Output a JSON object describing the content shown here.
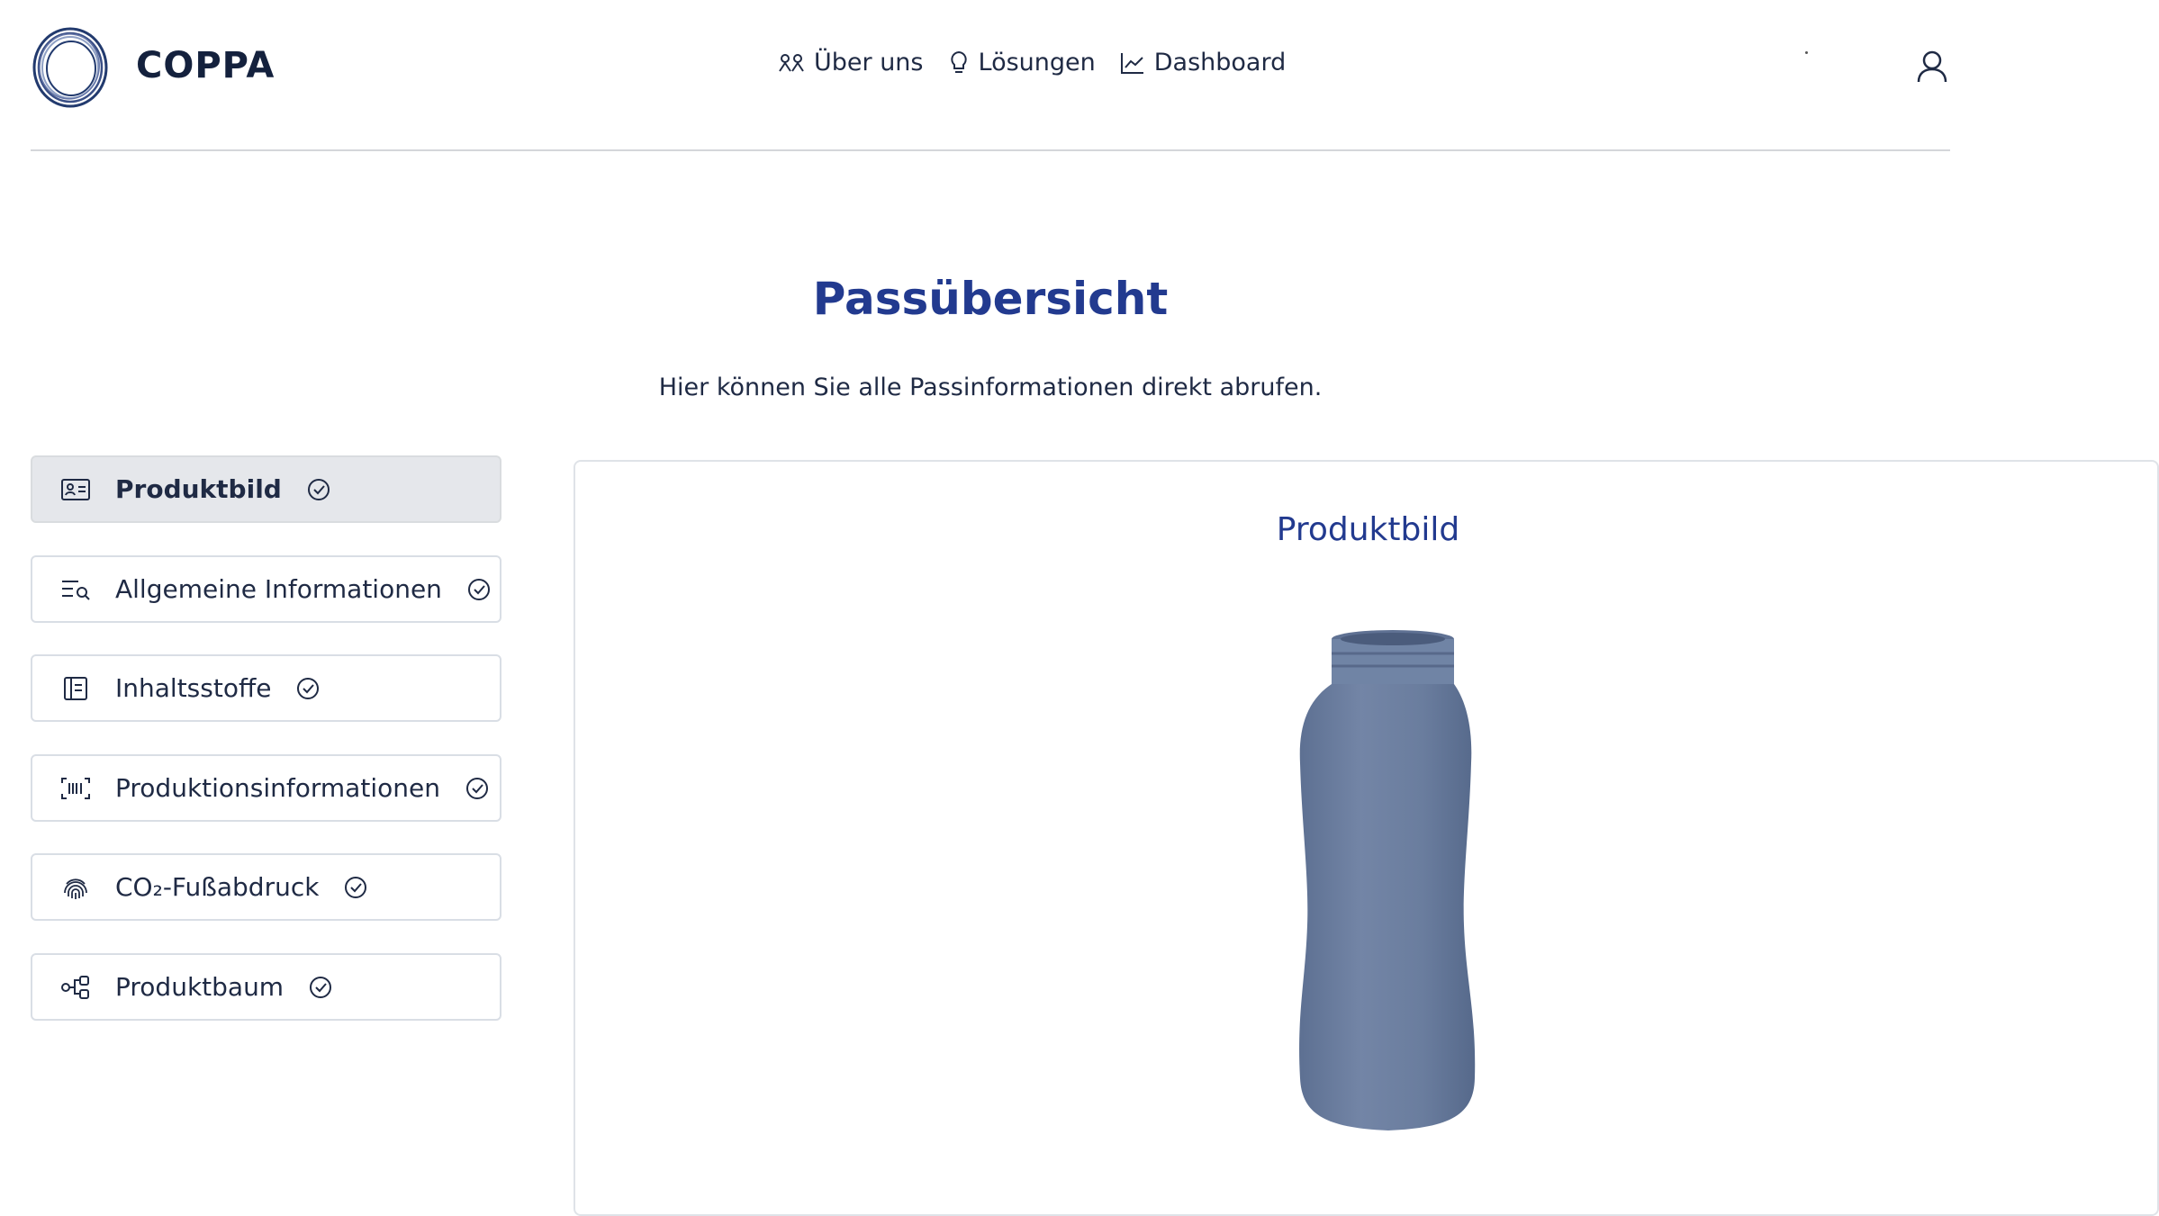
{
  "brand": {
    "name": "COPPA"
  },
  "nav": [
    {
      "label": "Über uns",
      "icon": "users-icon"
    },
    {
      "label": "Lösungen",
      "icon": "lightbulb-icon"
    },
    {
      "label": "Dashboard",
      "icon": "chart-line-icon"
    }
  ],
  "header": {
    "title": "Passübersicht",
    "subtitle": "Hier können Sie alle Passinformationen direkt abrufen."
  },
  "sidebar": {
    "items": [
      {
        "label": "Produktbild",
        "icon": "id-card-icon",
        "active": true
      },
      {
        "label": "Allgemeine Informationen",
        "icon": "list-search-icon",
        "active": false
      },
      {
        "label": "Inhaltsstoffe",
        "icon": "document-list-icon",
        "active": false
      },
      {
        "label": "Produktionsinformationen",
        "icon": "barcode-icon",
        "active": false
      },
      {
        "label": "CO₂-Fußabdruck",
        "icon": "fingerprint-icon",
        "active": false
      },
      {
        "label": "Produktbaum",
        "icon": "tree-icon",
        "active": false
      }
    ]
  },
  "panel": {
    "title": "Produktbild"
  },
  "colors": {
    "accent": "#223a8f",
    "bottle": "#6b7fa0",
    "active_bg": "#e5e7eb"
  }
}
